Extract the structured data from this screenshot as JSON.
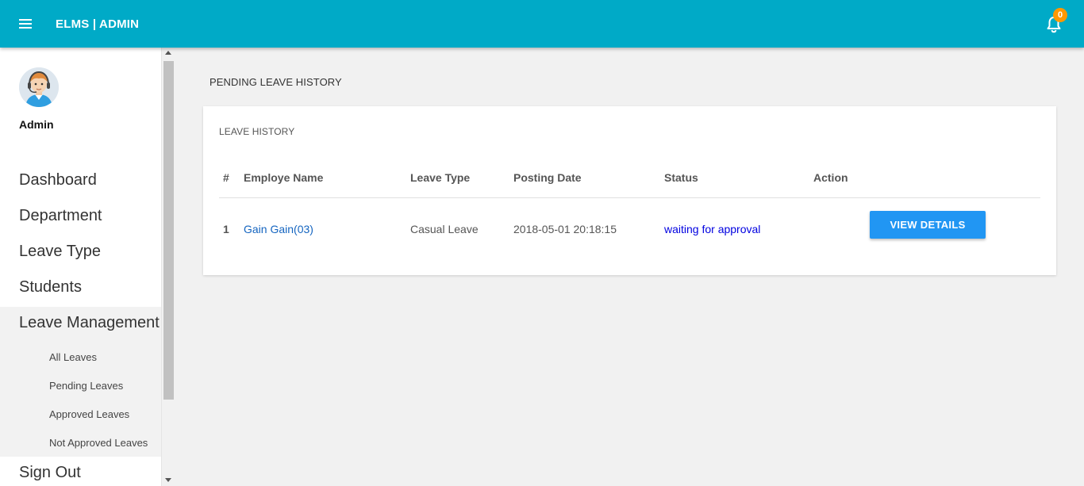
{
  "header": {
    "brand": "ELMS | ADMIN",
    "notification_count": "0",
    "bar_color": "#00aac7",
    "menu_icon": "hamburger-icon",
    "bell_icon": "bell-icon"
  },
  "sidebar": {
    "user_name": "Admin",
    "avatar_icon": "avatar-with-headset",
    "items": [
      {
        "label": "Dashboard"
      },
      {
        "label": "Department"
      },
      {
        "label": "Leave Type"
      },
      {
        "label": "Students"
      },
      {
        "label": "Leave Management"
      },
      {
        "label": "Sign Out"
      }
    ],
    "subitems": [
      {
        "label": "All Leaves"
      },
      {
        "label": "Pending Leaves"
      },
      {
        "label": "Approved Leaves"
      },
      {
        "label": "Not Approved Leaves"
      }
    ]
  },
  "main": {
    "page_title": "PENDING LEAVE HISTORY",
    "card_title": "LEAVE HISTORY",
    "columns": [
      "#",
      "Employe Name",
      "Leave Type",
      "Posting Date",
      "Status",
      "Action"
    ],
    "rows": [
      {
        "num": "1",
        "employee": "Gain Gain(03)",
        "leave_type": "Casual Leave",
        "posting_date": "2018-05-01 20:18:15",
        "status": "waiting for approval",
        "action_label": "VIEW DETAILS"
      }
    ],
    "button_color": "#2196f3",
    "status_color": "#0000e0"
  }
}
